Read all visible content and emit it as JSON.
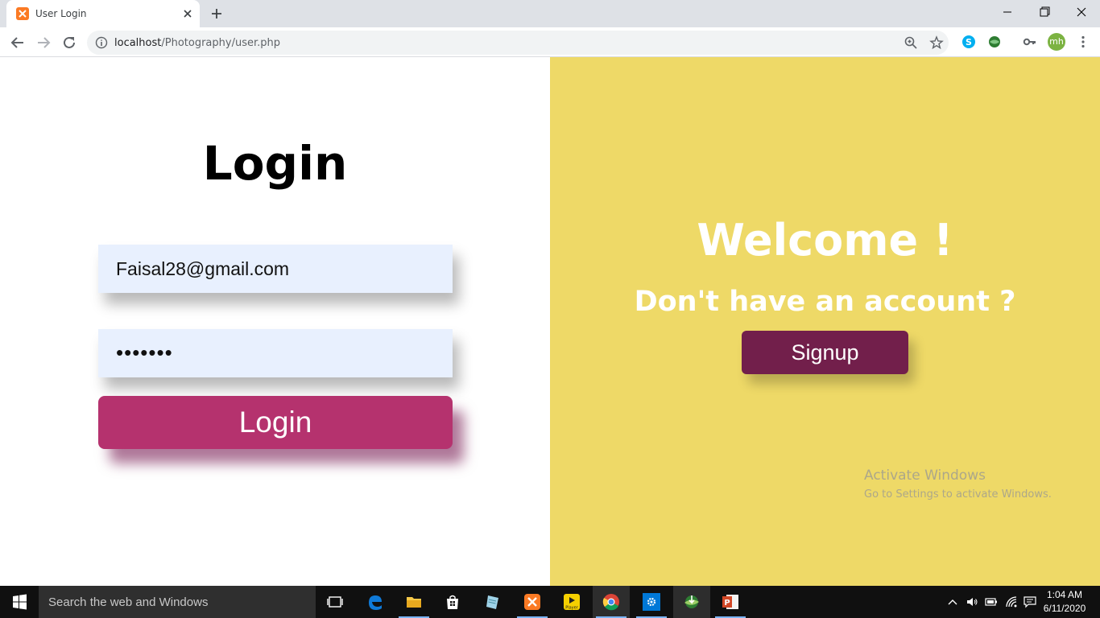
{
  "browser": {
    "tab_title": "User Login",
    "url_host": "localhost",
    "url_path": "/Photography/user.php",
    "profile_initials": "mh"
  },
  "login": {
    "title": "Login",
    "email_value": "Faisal28@gmail.com",
    "password_masked": "•••••••",
    "button_label": "Login"
  },
  "signup_panel": {
    "welcome": "Welcome !",
    "prompt": "Don't have an account ?",
    "button_label": "Signup"
  },
  "watermark": {
    "line1": "Activate Windows",
    "line2": "Go to Settings to activate Windows."
  },
  "taskbar": {
    "search_placeholder": "Search the web and Windows",
    "time": "1:04 AM",
    "date": "6/11/2020",
    "apps": [
      "task-view",
      "edge",
      "file-explorer",
      "store",
      "notepad",
      "xampp",
      "kmplayer",
      "chrome",
      "settings",
      "idm",
      "powerpoint"
    ]
  },
  "colors": {
    "page_left_bg": "#ffffff",
    "page_right_bg": "#eed967",
    "input_bg": "#e8f0fe",
    "login_button": "#b5326e",
    "signup_button": "#721f4b"
  }
}
